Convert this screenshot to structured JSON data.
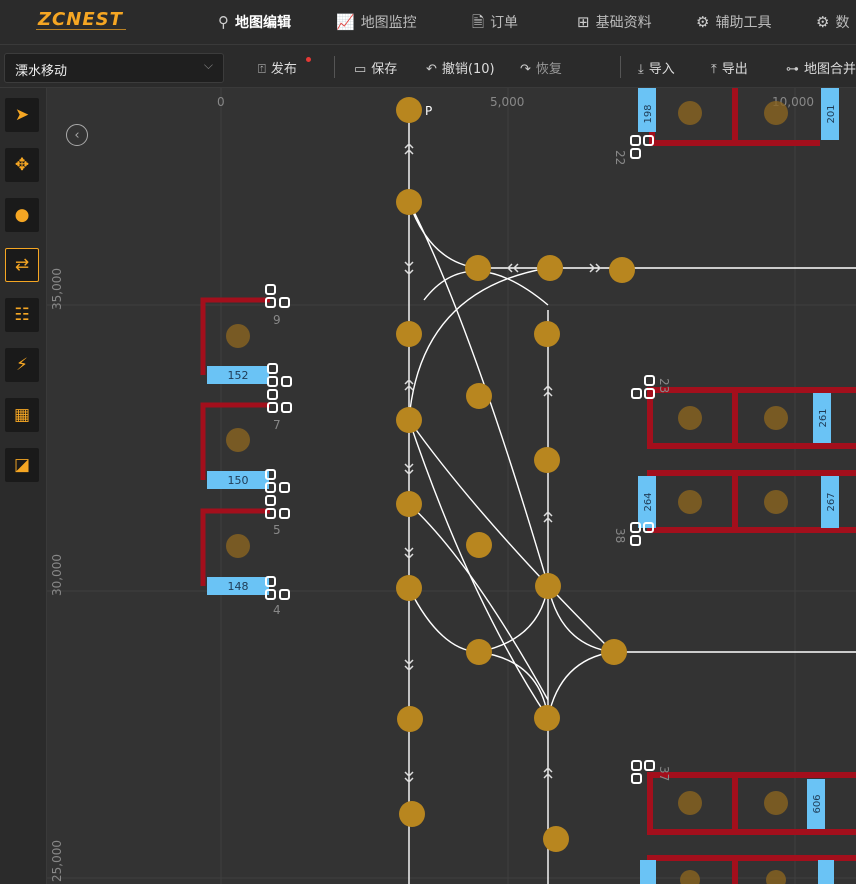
{
  "header": {
    "logo": "ZCNEST",
    "nav": [
      {
        "label": "地图编辑",
        "icon": "pin-icon",
        "active": true
      },
      {
        "label": "地图监控",
        "icon": "chart-icon",
        "active": false
      },
      {
        "label": "订单",
        "icon": "file-icon",
        "active": false
      },
      {
        "label": "基础资料",
        "icon": "sliders-icon",
        "active": false
      },
      {
        "label": "辅助工具",
        "icon": "gear-icon",
        "active": false
      },
      {
        "label": "数",
        "icon": "gear-icon",
        "active": false
      }
    ]
  },
  "toolbar": {
    "map_select": "溧水移动",
    "publish": "发布",
    "save": "保存",
    "undo": "撤销(10)",
    "redo": "恢复",
    "import": "导入",
    "export": "导出",
    "merge": "地图合并"
  },
  "sidebar": {
    "tools": [
      {
        "name": "select-tool",
        "icon": "cursor-icon",
        "selected": false
      },
      {
        "name": "move-tool",
        "icon": "move-icon",
        "selected": false
      },
      {
        "name": "point-tool",
        "icon": "circle-icon",
        "selected": false
      },
      {
        "name": "path-tool",
        "icon": "path-icon",
        "selected": true
      },
      {
        "name": "shelf-tool",
        "icon": "shelf-icon",
        "selected": false
      },
      {
        "name": "charger-tool",
        "icon": "charger-icon",
        "selected": false
      },
      {
        "name": "grid-tool",
        "icon": "grid-icon",
        "selected": false
      },
      {
        "name": "area-tool",
        "icon": "area-icon",
        "selected": false
      }
    ]
  },
  "map": {
    "x_ticks": [
      "0",
      "5,000",
      "10,000"
    ],
    "y_ticks": [
      "35,000",
      "30,000",
      "25,000"
    ],
    "point_label": "P",
    "left_labels": [
      "9",
      "7",
      "5",
      "4"
    ],
    "left_slot_numbers": [
      "152",
      "150",
      "148"
    ],
    "right_numbers": [
      "198",
      "201",
      "261",
      "264",
      "267",
      "606"
    ],
    "right_labels": [
      "22",
      "23",
      "38",
      "37"
    ],
    "colors": {
      "node": "#b8861f",
      "rack": "#a30f1c",
      "slot": "#6ac3f5",
      "path": "#ffffff",
      "accent": "#f5a623"
    }
  }
}
